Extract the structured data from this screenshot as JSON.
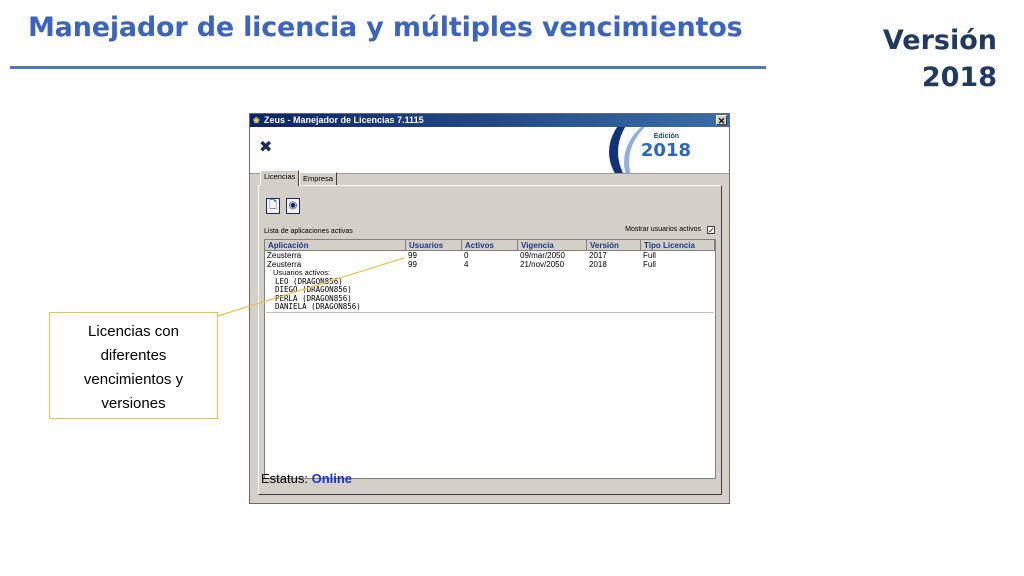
{
  "slide": {
    "title": "Manejador de licencia y múltiples vencimientos",
    "version_line1": "Versión",
    "version_line2": "2018",
    "callout_lines": [
      "Licencias con",
      "diferentes",
      "vencimientos y",
      "versiones"
    ]
  },
  "window": {
    "title": "Zeus - Manejador de Licencias 7.1115",
    "close_glyph": "✕",
    "banner": {
      "edition_label": "Edición",
      "edition_year": "2018"
    },
    "tabs": [
      "Licencias",
      "Empresa"
    ],
    "list_label": "Lista de aplicaciones activas",
    "show_active_label": "Mostrar usuarios activos",
    "show_active_checked": "✓",
    "columns": [
      "Aplicación",
      "Usuarios",
      "Activos",
      "Vigencia",
      "Versión",
      "Tipo Licencia"
    ],
    "rows": [
      [
        "Zeusterra",
        "99",
        "0",
        "09/mar/2050",
        "2017",
        "Full"
      ],
      [
        "Zeusterra",
        "99",
        "4",
        "21/nov/2050",
        "2018",
        "Full"
      ]
    ],
    "active_users_header": "Usuarios activos:",
    "active_users": [
      "LEO  (DRAGON856)",
      "DIEGO  (DRAGON856)",
      "PERLA  (DRAGON856)",
      "DANIELA  (DRAGON856)"
    ],
    "status_label": "Estatus:",
    "status_value": "Online"
  },
  "colors": {
    "title": "#3b64c2",
    "status_online": "#1a34d4",
    "callout_border": "#f0c040"
  }
}
